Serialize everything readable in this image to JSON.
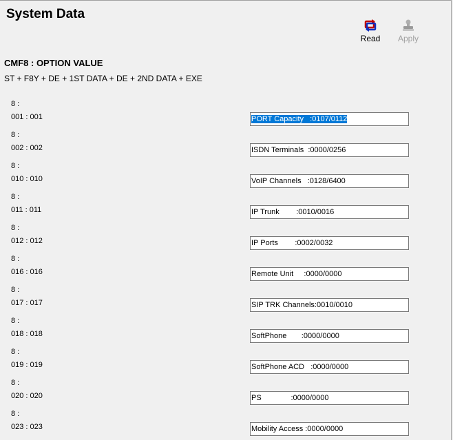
{
  "header": {
    "title": "System Data"
  },
  "toolbar": {
    "read_label": "Read",
    "apply_label": "Apply",
    "read_icon": "refresh-arrows-icon",
    "apply_icon": "stamp-icon"
  },
  "section": {
    "title": "CMF8 : OPTION VALUE",
    "instruction": "ST + F8Y + DE + 1ST DATA + DE + 2ND DATA + EXE"
  },
  "rows": [
    {
      "label_top": "8 :",
      "label_bottom": "001 : 001",
      "value": "PORT Capacity   :0107/0112",
      "selected": true
    },
    {
      "label_top": "8 :",
      "label_bottom": "002 : 002",
      "value": "ISDN Terminals  :0000/0256",
      "selected": false
    },
    {
      "label_top": "8 :",
      "label_bottom": "010 : 010",
      "value": "VoIP Channels   :0128/6400",
      "selected": false
    },
    {
      "label_top": "8 :",
      "label_bottom": "011 : 011",
      "value": "IP Trunk        :0010/0016",
      "selected": false
    },
    {
      "label_top": "8 :",
      "label_bottom": "012 : 012",
      "value": "IP Ports        :0002/0032",
      "selected": false
    },
    {
      "label_top": "8 :",
      "label_bottom": "016 : 016",
      "value": "Remote Unit     :0000/0000",
      "selected": false
    },
    {
      "label_top": "8 :",
      "label_bottom": "017 : 017",
      "value": "SIP TRK Channels:0010/0010",
      "selected": false
    },
    {
      "label_top": "8 :",
      "label_bottom": "018 : 018",
      "value": "SoftPhone       :0000/0000",
      "selected": false
    },
    {
      "label_top": "8 :",
      "label_bottom": "019 : 019",
      "value": "SoftPhone ACD   :0000/0000",
      "selected": false
    },
    {
      "label_top": "8 :",
      "label_bottom": "020 : 020",
      "value": "PS              :0000/0000",
      "selected": false
    },
    {
      "label_top": "8 :",
      "label_bottom": "023 : 023",
      "value": "Mobility Access :0000/0000",
      "selected": false
    }
  ],
  "colors": {
    "background": "#f0f0f0",
    "selection": "#0078d7",
    "disabled_text": "#a0a0a0"
  }
}
